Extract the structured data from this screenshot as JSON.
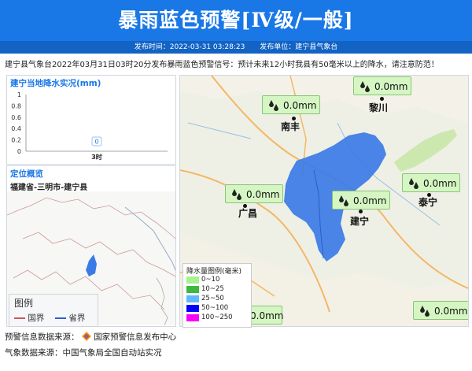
{
  "header": {
    "title": "暴雨蓝色预警[Ⅳ级/一般]",
    "publish_time": "发布时间：2022-03-31 03:28:23",
    "publisher": "发布单位：建宁县气象台"
  },
  "notice": "建宁县气象台2022年03月31日03时20分发布暴雨蓝色预警信号：预计未来12小时我县有50毫米以上的降水，请注意防范！",
  "rain_panel": {
    "title": "建宁当地降水实况(mm)",
    "chart_data": {
      "type": "bar",
      "categories": [
        "3时"
      ],
      "values": [
        0
      ],
      "ylim": [
        0,
        1
      ],
      "yticks": [
        "0",
        "0.2",
        "0.4",
        "0.6",
        "0.8",
        "1"
      ],
      "data_labels": [
        "0"
      ]
    }
  },
  "location_panel": {
    "title": "定位概览",
    "path": "福建省-三明市-建宁县",
    "legend": {
      "title": "图例",
      "items": [
        "国界",
        "省界"
      ]
    }
  },
  "main_map": {
    "stations": [
      {
        "value": "0.0mm"
      },
      {
        "value": "0.0mm"
      },
      {
        "value": "0.0mm"
      },
      {
        "value": "0.0mm"
      },
      {
        "value": "0.0mm"
      },
      {
        "value": "0.0mm"
      },
      {
        "value": "0.0mm"
      }
    ],
    "places": [
      "黎川",
      "南丰",
      "广昌",
      "建宁",
      "泰宁"
    ],
    "legend": {
      "title": "降水量图例(毫米)",
      "items": [
        {
          "label": "0~10",
          "color": "#a6f28f"
        },
        {
          "label": "10~25",
          "color": "#3dba3d"
        },
        {
          "label": "25~50",
          "color": "#61b8ff"
        },
        {
          "label": "50~100",
          "color": "#0000fe"
        },
        {
          "label": "100~250",
          "color": "#fa00fa"
        }
      ]
    }
  },
  "footer": {
    "warning_source_label": "预警信息数据来源：",
    "warning_source": "国家预警信息发布中心",
    "weather_source": "气象数据来源：中国气象局全国自动站实况"
  },
  "colors": {
    "header_blue": "#1a78e6",
    "subbar_blue": "#1263c4",
    "warning_area": "#3b7be6"
  },
  "icons": [
    "raindrop-icon",
    "national-warning-logo-icon"
  ]
}
